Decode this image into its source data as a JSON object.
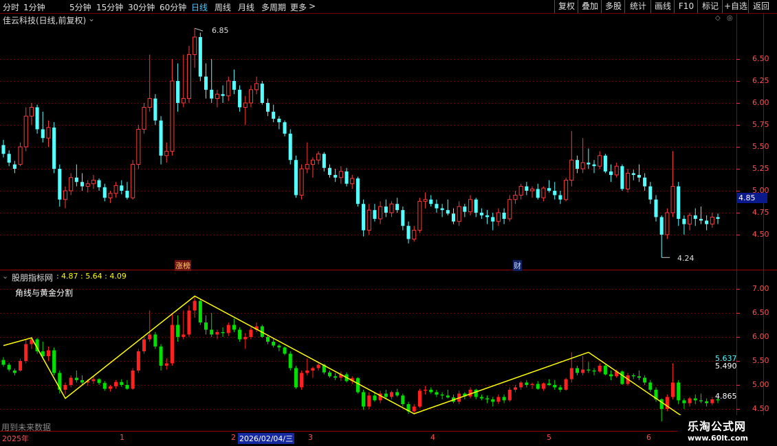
{
  "toolbar": {
    "periods": [
      "分时",
      "1分钟",
      "5分钟",
      "15分钟",
      "30分钟",
      "60分钟",
      "日线",
      "周线",
      "月线",
      "多周期",
      "更多"
    ],
    "active_period": "日线",
    "buttons": [
      "复权",
      "叠加",
      "多股",
      "统计",
      "画线",
      "F10",
      "标记",
      "+自选",
      "返回"
    ]
  },
  "main_chart": {
    "title": "佳云科技(日线,前复权)",
    "price_ticks": [
      "6.50",
      "6.25",
      "6.00",
      "5.75",
      "5.50",
      "5.25",
      "5.00",
      "4.75",
      "4.50"
    ],
    "current_price": "4.85",
    "high_label": "6.85",
    "low_label": "4.24",
    "events": [
      "涨榜",
      "财"
    ]
  },
  "indicator": {
    "name": "股朋指标网",
    "values": "4.87 : 5.64 : 4.09",
    "subtitle": "角线与黄金分割",
    "ticks": [
      "7.00",
      "6.50",
      "6.00",
      "5.50",
      "5.00",
      "4.50"
    ],
    "right_labels": [
      "5.637",
      "5.490",
      "4.865"
    ],
    "footer_note": "用到未来数据"
  },
  "time_axis": {
    "labels": [
      "2025年",
      "1",
      "2",
      "3",
      "4",
      "5",
      "6"
    ],
    "cursor_date": "2026/02/04/三"
  },
  "watermark": {
    "title": "乐淘公式网",
    "url": "www.60lt.com"
  },
  "colors": {
    "up": "#ff3c3c",
    "down": "#54ffff",
    "grid": "#7a0000",
    "zigzag": "#ffff00"
  },
  "chart_data": {
    "type": "candlestick",
    "ylim": [
      4.24,
      6.85
    ],
    "candles": [
      [
        5.52,
        5.58,
        5.38,
        5.42
      ],
      [
        5.42,
        5.46,
        5.28,
        5.32
      ],
      [
        5.3,
        5.34,
        5.2,
        5.25
      ],
      [
        5.3,
        5.55,
        5.28,
        5.5
      ],
      [
        5.5,
        5.95,
        5.45,
        5.85
      ],
      [
        5.85,
        6.0,
        5.75,
        5.95
      ],
      [
        5.95,
        5.98,
        5.65,
        5.7
      ],
      [
        5.7,
        5.9,
        5.55,
        5.6
      ],
      [
        5.6,
        5.8,
        5.5,
        5.72
      ],
      [
        5.72,
        5.78,
        5.2,
        5.25
      ],
      [
        5.25,
        5.3,
        4.82,
        4.9
      ],
      [
        4.9,
        5.05,
        4.8,
        5.0
      ],
      [
        5.0,
        5.2,
        4.95,
        5.15
      ],
      [
        5.15,
        5.3,
        5.05,
        5.1
      ],
      [
        5.1,
        5.2,
        5.0,
        5.05
      ],
      [
        5.05,
        5.12,
        4.98,
        5.08
      ],
      [
        5.08,
        5.18,
        5.02,
        5.12
      ],
      [
        5.12,
        5.14,
        5.0,
        5.04
      ],
      [
        5.04,
        5.08,
        4.88,
        4.92
      ],
      [
        4.92,
        5.0,
        4.86,
        4.97
      ],
      [
        4.97,
        5.1,
        4.92,
        5.06
      ],
      [
        5.06,
        5.12,
        4.96,
        5.0
      ],
      [
        5.0,
        5.1,
        4.9,
        4.92
      ],
      [
        4.92,
        5.35,
        4.9,
        5.3
      ],
      [
        5.3,
        5.75,
        5.25,
        5.7
      ],
      [
        5.7,
        6.0,
        5.65,
        5.95
      ],
      [
        5.95,
        6.55,
        5.9,
        6.05
      ],
      [
        6.05,
        6.1,
        5.75,
        5.8
      ],
      [
        5.8,
        5.85,
        5.3,
        5.4
      ],
      [
        5.4,
        5.55,
        5.32,
        5.45
      ],
      [
        5.45,
        6.5,
        5.4,
        6.25
      ],
      [
        6.25,
        6.45,
        5.9,
        6.0
      ],
      [
        6.0,
        6.55,
        5.95,
        6.05
      ],
      [
        6.05,
        6.65,
        6.0,
        6.55
      ],
      [
        6.55,
        6.85,
        6.4,
        6.75
      ],
      [
        6.75,
        6.8,
        6.25,
        6.3
      ],
      [
        6.3,
        6.45,
        6.05,
        6.15
      ],
      [
        6.15,
        6.5,
        6.0,
        6.05
      ],
      [
        6.05,
        6.15,
        5.95,
        6.1
      ],
      [
        6.1,
        6.2,
        6.0,
        6.08
      ],
      [
        6.08,
        6.3,
        6.02,
        6.25
      ],
      [
        6.25,
        6.38,
        6.1,
        6.15
      ],
      [
        6.15,
        6.2,
        5.9,
        5.95
      ],
      [
        5.95,
        6.08,
        5.75,
        6.0
      ],
      [
        6.0,
        6.2,
        5.95,
        6.15
      ],
      [
        6.15,
        6.3,
        6.1,
        6.22
      ],
      [
        6.22,
        6.25,
        5.98,
        6.0
      ],
      [
        6.0,
        6.05,
        5.85,
        5.9
      ],
      [
        5.9,
        5.98,
        5.78,
        5.82
      ],
      [
        5.82,
        5.85,
        5.7,
        5.78
      ],
      [
        5.78,
        5.8,
        5.62,
        5.65
      ],
      [
        5.65,
        5.7,
        5.3,
        5.35
      ],
      [
        5.35,
        5.4,
        4.92,
        4.95
      ],
      [
        4.95,
        5.3,
        4.9,
        5.25
      ],
      [
        5.25,
        5.55,
        5.2,
        5.3
      ],
      [
        5.3,
        5.38,
        5.15,
        5.35
      ],
      [
        5.35,
        5.45,
        5.3,
        5.42
      ],
      [
        5.42,
        5.44,
        5.22,
        5.26
      ],
      [
        5.26,
        5.3,
        5.15,
        5.18
      ],
      [
        5.18,
        5.25,
        5.1,
        5.15
      ],
      [
        5.15,
        5.28,
        5.08,
        5.22
      ],
      [
        5.22,
        5.26,
        5.05,
        5.08
      ],
      [
        5.08,
        5.18,
        5.02,
        5.14
      ],
      [
        5.14,
        5.16,
        4.82,
        4.85
      ],
      [
        4.85,
        4.9,
        4.48,
        4.55
      ],
      [
        4.55,
        4.85,
        4.5,
        4.78
      ],
      [
        4.78,
        4.85,
        4.65,
        4.68
      ],
      [
        4.68,
        4.88,
        4.62,
        4.82
      ],
      [
        4.82,
        4.9,
        4.7,
        4.75
      ],
      [
        4.75,
        4.88,
        4.7,
        4.85
      ],
      [
        4.85,
        4.92,
        4.75,
        4.78
      ],
      [
        4.78,
        4.82,
        4.55,
        4.6
      ],
      [
        4.6,
        4.65,
        4.4,
        4.45
      ],
      [
        4.45,
        4.6,
        4.42,
        4.55
      ],
      [
        4.55,
        4.92,
        4.52,
        4.88
      ],
      [
        4.88,
        4.98,
        4.8,
        4.9
      ],
      [
        4.9,
        4.95,
        4.82,
        4.85
      ],
      [
        4.85,
        4.9,
        4.75,
        4.8
      ],
      [
        4.8,
        4.85,
        4.7,
        4.78
      ],
      [
        4.78,
        4.9,
        4.72,
        4.74
      ],
      [
        4.74,
        4.8,
        4.62,
        4.65
      ],
      [
        4.65,
        4.88,
        4.6,
        4.82
      ],
      [
        4.82,
        4.85,
        4.7,
        4.76
      ],
      [
        4.76,
        4.95,
        4.72,
        4.9
      ],
      [
        4.9,
        4.92,
        4.7,
        4.75
      ],
      [
        4.75,
        4.8,
        4.68,
        4.72
      ],
      [
        4.72,
        4.78,
        4.62,
        4.7
      ],
      [
        4.7,
        4.75,
        4.55,
        4.65
      ],
      [
        4.65,
        4.8,
        4.6,
        4.75
      ],
      [
        4.75,
        4.8,
        4.62,
        4.68
      ],
      [
        4.68,
        4.95,
        4.65,
        4.9
      ],
      [
        4.9,
        5.0,
        4.85,
        4.95
      ],
      [
        4.95,
        5.08,
        4.9,
        5.05
      ],
      [
        5.05,
        5.1,
        4.95,
        5.0
      ],
      [
        5.0,
        5.05,
        4.92,
        5.02
      ],
      [
        5.02,
        5.08,
        4.9,
        4.92
      ],
      [
        4.92,
        5.05,
        4.88,
        5.03
      ],
      [
        5.03,
        5.12,
        4.98,
        5.0
      ],
      [
        5.0,
        5.1,
        4.9,
        4.95
      ],
      [
        4.95,
        5.0,
        4.85,
        4.9
      ],
      [
        4.9,
        5.15,
        4.88,
        5.12
      ],
      [
        5.12,
        5.68,
        5.05,
        5.35
      ],
      [
        5.35,
        5.4,
        5.2,
        5.25
      ],
      [
        5.25,
        5.6,
        5.2,
        5.32
      ],
      [
        5.32,
        5.48,
        5.25,
        5.3
      ],
      [
        5.3,
        5.35,
        5.2,
        5.28
      ],
      [
        5.28,
        5.45,
        5.25,
        5.4
      ],
      [
        5.4,
        5.42,
        5.2,
        5.22
      ],
      [
        5.22,
        5.3,
        5.1,
        5.18
      ],
      [
        5.18,
        5.32,
        5.15,
        5.28
      ],
      [
        5.28,
        5.3,
        5.0,
        5.02
      ],
      [
        5.02,
        5.25,
        4.98,
        5.2
      ],
      [
        5.2,
        5.24,
        5.12,
        5.18
      ],
      [
        5.18,
        5.3,
        5.1,
        5.15
      ],
      [
        5.15,
        5.2,
        5.0,
        5.05
      ],
      [
        5.05,
        5.1,
        4.85,
        4.9
      ],
      [
        4.9,
        4.95,
        4.65,
        4.7
      ],
      [
        4.7,
        4.72,
        4.24,
        4.5
      ],
      [
        4.5,
        4.8,
        4.45,
        4.75
      ],
      [
        4.75,
        5.45,
        4.7,
        5.05
      ],
      [
        5.05,
        5.1,
        4.6,
        4.68
      ],
      [
        4.68,
        4.72,
        4.5,
        4.62
      ],
      [
        4.62,
        4.75,
        4.55,
        4.72
      ],
      [
        4.72,
        4.8,
        4.6,
        4.68
      ],
      [
        4.68,
        4.82,
        4.62,
        4.66
      ],
      [
        4.66,
        4.72,
        4.55,
        4.62
      ],
      [
        4.62,
        4.75,
        4.58,
        4.7
      ],
      [
        4.7,
        4.74,
        4.62,
        4.68
      ]
    ],
    "zigzag": [
      [
        0,
        5.82
      ],
      [
        5,
        5.98
      ],
      [
        11,
        4.72
      ],
      [
        34,
        6.85
      ],
      [
        73,
        4.4
      ],
      [
        104,
        5.68
      ],
      [
        122,
        4.24
      ]
    ]
  }
}
